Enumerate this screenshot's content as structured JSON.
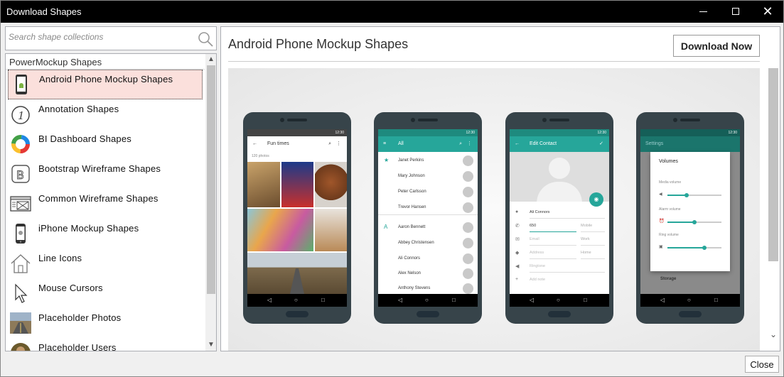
{
  "window": {
    "title": "Download Shapes"
  },
  "search": {
    "placeholder": "Search shape collections"
  },
  "list": {
    "group": "PowerMockup Shapes",
    "items": [
      {
        "label": "Android Phone Mockup Shapes",
        "icon": "android-phone-icon",
        "selected": true
      },
      {
        "label": "Annotation Shapes",
        "icon": "annotation-circle-icon"
      },
      {
        "label": "BI Dashboard Shapes",
        "icon": "donut-chart-icon"
      },
      {
        "label": "Bootstrap Wireframe Shapes",
        "icon": "bootstrap-b-icon"
      },
      {
        "label": "Common Wireframe Shapes",
        "icon": "wireframe-image-icon"
      },
      {
        "label": "iPhone Mockup Shapes",
        "icon": "iphone-icon"
      },
      {
        "label": "Line Icons",
        "icon": "house-outline-icon"
      },
      {
        "label": "Mouse Cursors",
        "icon": "cursor-arrow-icon"
      },
      {
        "label": "Placeholder Photos",
        "icon": "road-photo-icon"
      },
      {
        "label": "Placeholder Users",
        "icon": "user-photo-icon"
      }
    ]
  },
  "detail": {
    "title": "Android Phone Mockup Shapes",
    "download_label": "Download Now"
  },
  "preview": {
    "status_time": "12:30",
    "phone1": {
      "title": "Fun times",
      "subtitle": "120 photos"
    },
    "phone2": {
      "title": "All",
      "contacts": [
        "Janet Perkins",
        "Mary Johnson",
        "Peter Carlsson",
        "Trevor Hansen",
        "Aaron Bennett",
        "Abbey Christensen",
        "Ali Connors",
        "Alex Nelson",
        "Anthony Stevens"
      ],
      "section_letter": "A"
    },
    "phone3": {
      "title": "Edit Contact",
      "name": "Ali Connors",
      "phone": "650",
      "phone_type": "Mobile",
      "email_placeholder": "Email",
      "email_type": "Work",
      "address_placeholder": "Address",
      "address_type": "Home",
      "ringtone": "Ringtone",
      "add_note": "Add note"
    },
    "phone4": {
      "title": "Settings",
      "dialog_title": "Volumes",
      "media": "Media volume",
      "alarm": "Alarm volume",
      "ring": "Ring volume",
      "storage": "Storage"
    }
  },
  "footer": {
    "close_label": "Close"
  },
  "colors": {
    "accent": "#26a69a",
    "selected_bg": "#fbe0dc"
  }
}
